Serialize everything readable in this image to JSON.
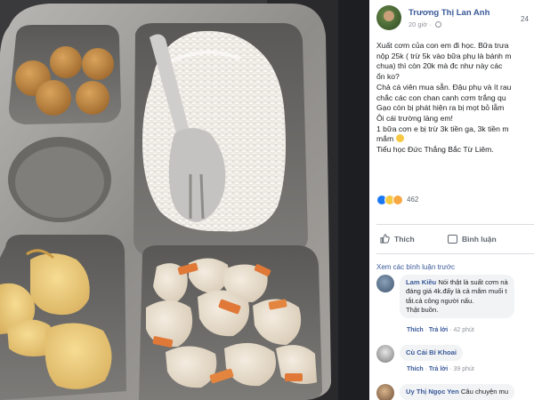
{
  "post": {
    "author": "Trương Thị Lan Anh",
    "time": "20 giờ",
    "body_lines": [
      "Xuất cơm của con em đi học. Bữa trưa",
      "nộp 25k ( trừ 5k vào bữa phụ là bánh m",
      "chua) thì còn 20k mà đc như này các",
      "ổn ko?",
      "Chả cá viên mua sẵn. Đậu phụ và ít rau",
      "chắc các con chan canh cơm trắng qu",
      "Gạo còn bị phát hiện ra bị mọt bỏ lẫm",
      "Ôi cái trường làng em!",
      "1 bữa cơn e bị trừ 3k tiền ga, 3k tiền m",
      "mắm",
      "Tiểu học Đức Thắng Bắc Từ Liêm."
    ],
    "reaction_count": "462",
    "share_count": "24"
  },
  "actions": {
    "like_label": "Thích",
    "comment_label": "Bình luận"
  },
  "comments_link": "Xem các bình luận trước",
  "comments": [
    {
      "name": "Lam Kiều",
      "lines": [
        "Nói thật là suất cơm nà",
        "đáng giá 4k.đấy là cả mắm muối t",
        "tắt.cả công người nấu.",
        "Thật buồn."
      ],
      "like": "Thích",
      "reply": "Trả lời",
      "time": "42 phút"
    },
    {
      "name": "Cù Cải Bí Khoai",
      "lines": [],
      "like": "Thích",
      "reply": "Trả lời",
      "time": "39 phút"
    },
    {
      "name": "Uy Thị Ngọc Yen",
      "lines": [
        "Câu chuyện mu"
      ],
      "like": "",
      "reply": "",
      "time": ""
    }
  ],
  "colors": {
    "link_blue": "#385898",
    "fb_blue": "#1877f2",
    "gray_text": "#606770",
    "tray_steel": "#9a9894",
    "dark_background": "#1c1e21"
  }
}
